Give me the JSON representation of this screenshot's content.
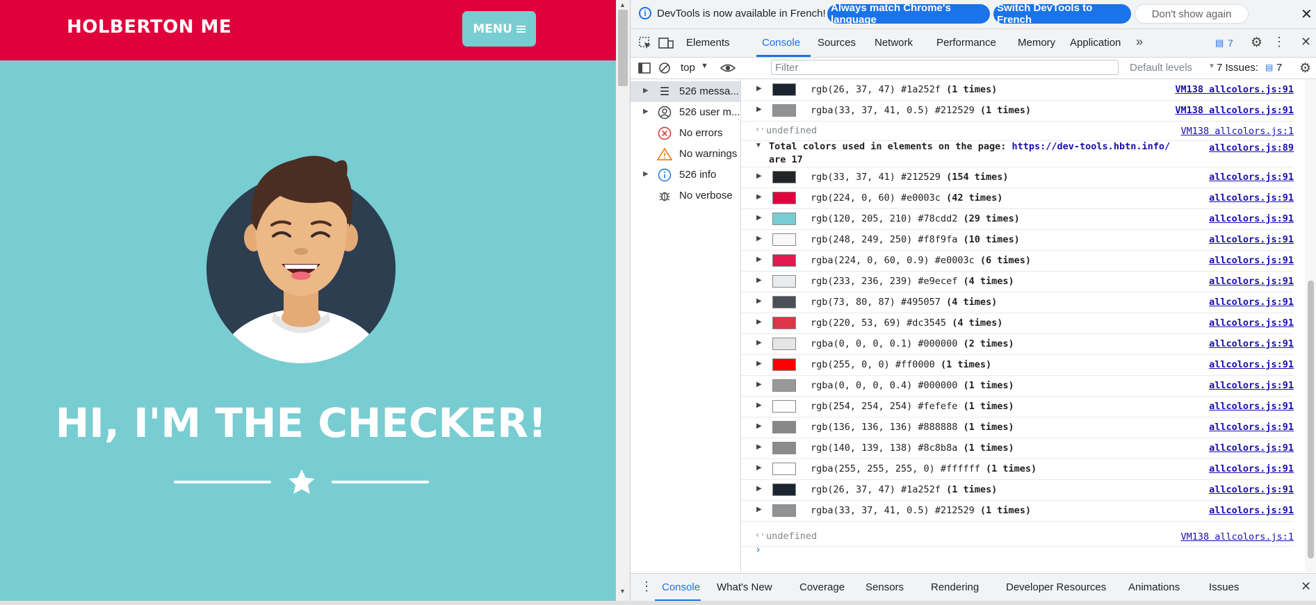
{
  "page": {
    "brand": "HOLBERTON ME",
    "menu_label": "MENU",
    "hero_title": "HI, I'M THE CHECKER!",
    "colors": {
      "nav": "#e0003c",
      "background": "#78cdd2"
    }
  },
  "devtools": {
    "infobar": {
      "message": "DevTools is now available in French!",
      "match_button": "Always match Chrome's language",
      "switch_button": "Switch DevTools to French",
      "dismiss_button": "Don't show again"
    },
    "tabs": [
      "Elements",
      "Console",
      "Sources",
      "Network",
      "Performance",
      "Memory",
      "Application"
    ],
    "active_tab": "Console",
    "issues_badge": "7",
    "toolbar": {
      "context": "top",
      "filter_placeholder": "Filter",
      "levels": "Default levels",
      "issues_label": "7 Issues:",
      "issues_count": "7"
    },
    "sidebar": [
      {
        "label": "526 messa...",
        "icon": "list-icon"
      },
      {
        "label": "526 user m...",
        "icon": "user-icon"
      },
      {
        "label": "No errors",
        "icon": "error-icon"
      },
      {
        "label": "No warnings",
        "icon": "warning-icon"
      },
      {
        "label": "526 info",
        "icon": "info-icon"
      },
      {
        "label": "No verbose",
        "icon": "bug-icon"
      }
    ],
    "console": {
      "top_rows": [
        {
          "swatch": "#1a252f",
          "text": "rgb(26, 37, 47) #1a252f",
          "count": "(1 times)",
          "source": "VM138 allcolors.js:91"
        },
        {
          "swatch": "rgba(33,37,41,0.5)",
          "text": "rgba(33, 37, 41, 0.5) #212529",
          "count": "(1 times)",
          "source": "VM138 allcolors.js:91"
        }
      ],
      "undefined_1": {
        "text": "undefined",
        "source": "VM138 allcolors.js:1"
      },
      "group": {
        "title": "Total colors used in elements on the page:",
        "link": "https://dev-tools.hbtn.info/",
        "suffix": "are 17",
        "source": "allcolors.js:89"
      },
      "rows": [
        {
          "swatch": "#212529",
          "text": "rgb(33, 37, 41) #212529",
          "count": "(154 times)",
          "source": "allcolors.js:91"
        },
        {
          "swatch": "#e0003c",
          "text": "rgb(224, 0, 60) #e0003c",
          "count": "(42 times)",
          "source": "allcolors.js:91"
        },
        {
          "swatch": "#78cdd2",
          "text": "rgb(120, 205, 210) #78cdd2",
          "count": "(29 times)",
          "source": "allcolors.js:91"
        },
        {
          "swatch": "#f8f9fa",
          "text": "rgb(248, 249, 250) #f8f9fa",
          "count": "(10 times)",
          "source": "allcolors.js:91"
        },
        {
          "swatch": "rgba(224,0,60,0.9)",
          "text": "rgba(224, 0, 60, 0.9) #e0003c",
          "count": "(6 times)",
          "source": "allcolors.js:91"
        },
        {
          "swatch": "#e9ecef",
          "text": "rgb(233, 236, 239) #e9ecef",
          "count": "(4 times)",
          "source": "allcolors.js:91"
        },
        {
          "swatch": "#495057",
          "text": "rgb(73, 80, 87) #495057",
          "count": "(4 times)",
          "source": "allcolors.js:91"
        },
        {
          "swatch": "#dc3545",
          "text": "rgb(220, 53, 69) #dc3545",
          "count": "(4 times)",
          "source": "allcolors.js:91"
        },
        {
          "swatch": "rgba(0,0,0,0.1)",
          "text": "rgba(0, 0, 0, 0.1) #000000",
          "count": "(2 times)",
          "source": "allcolors.js:91"
        },
        {
          "swatch": "#ff0000",
          "text": "rgb(255, 0, 0) #ff0000",
          "count": "(1 times)",
          "source": "allcolors.js:91"
        },
        {
          "swatch": "rgba(0,0,0,0.4)",
          "text": "rgba(0, 0, 0, 0.4) #000000",
          "count": "(1 times)",
          "source": "allcolors.js:91"
        },
        {
          "swatch": "#fefefe",
          "text": "rgb(254, 254, 254) #fefefe",
          "count": "(1 times)",
          "source": "allcolors.js:91"
        },
        {
          "swatch": "#888888",
          "text": "rgb(136, 136, 136) #888888",
          "count": "(1 times)",
          "source": "allcolors.js:91"
        },
        {
          "swatch": "#8c8b8a",
          "text": "rgb(140, 139, 138) #8c8b8a",
          "count": "(1 times)",
          "source": "allcolors.js:91"
        },
        {
          "swatch": "rgba(255,255,255,0)",
          "text": "rgba(255, 255, 255, 0) #ffffff",
          "count": "(1 times)",
          "source": "allcolors.js:91"
        },
        {
          "swatch": "#1a252f",
          "text": "rgb(26, 37, 47) #1a252f",
          "count": "(1 times)",
          "source": "allcolors.js:91"
        },
        {
          "swatch": "rgba(33,37,41,0.5)",
          "text": "rgba(33, 37, 41, 0.5) #212529",
          "count": "(1 times)",
          "source": "allcolors.js:91"
        }
      ],
      "undefined_2": {
        "text": "undefined",
        "source": "VM138 allcolors.js:1"
      }
    },
    "drawer_tabs": [
      "Console",
      "What's New",
      "Coverage",
      "Sensors",
      "Rendering",
      "Developer Resources",
      "Animations",
      "Issues"
    ]
  }
}
